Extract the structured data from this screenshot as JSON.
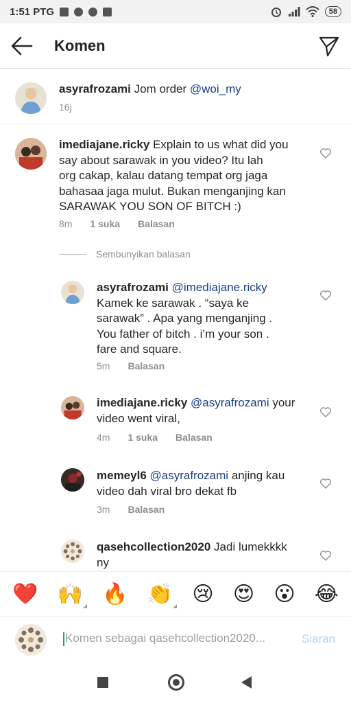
{
  "status_bar": {
    "time": "1:51 PTG",
    "battery": "58",
    "icons_left": [
      "message-icon",
      "facebook-icon",
      "app-icon",
      "store-icon"
    ],
    "icons_right": [
      "alarm-icon",
      "signal-icon",
      "wifi-icon",
      "battery-icon"
    ]
  },
  "header": {
    "title": "Komen",
    "back_icon": "arrow-left-icon",
    "send_icon": "paper-plane-icon"
  },
  "caption": {
    "username": "asyrafrozami",
    "text": "Jom order",
    "mention": "@woi_my",
    "time": "16j"
  },
  "comments": [
    {
      "username": "imediajane.ricky",
      "lines": [
        "Explain to us what did you",
        "say about sarawak in you video? Itu lah",
        "org  cakap, kalau datang tempat org jaga",
        "bahasaa jaga mulut. Bukan menganjing kan",
        "SARAWAK YOU SON OF BITCH :)"
      ],
      "time": "8m",
      "likes": "1 suka",
      "reply": "Balasan"
    }
  ],
  "hide_replies": "Sembunyikan balasan",
  "replies": [
    {
      "username": "asyrafrozami",
      "mention": "@imediajane.ricky",
      "lines": [
        "Kamek ke sarawak . “saya ke",
        "sarawak” . Apa yang menganjing .",
        "You father of bitch . i’m your son .",
        "fare and square."
      ],
      "time": "5m",
      "likes": "",
      "reply": "Balasan"
    },
    {
      "username": "imediajane.ricky",
      "mention": "@asyrafrozami",
      "first_line_rest": "your",
      "lines": [
        "video went viral,"
      ],
      "time": "4m",
      "likes": "1 suka",
      "reply": "Balasan"
    },
    {
      "username": "memeyl6",
      "mention": "@asyrafrozami",
      "first_line_rest": "anjing kau",
      "lines": [
        "video dah viral bro dekat fb"
      ],
      "time": "3m",
      "likes": "",
      "reply": "Balasan"
    },
    {
      "username": "qasehcollection2020",
      "first_line_rest": "Jadi lumekkkk",
      "lines": [
        "ny"
      ]
    }
  ],
  "emoji_bar": [
    "❤️",
    "🙌",
    "🔥",
    "👏",
    "😢",
    "😍",
    "😮",
    "😂"
  ],
  "input": {
    "placeholder": "Komen sebagai qasehcollection2020...",
    "post_label": "Siaran"
  },
  "colors": {
    "mention": "#1a3f8a",
    "secondary_text": "#8e8e8e",
    "post_disabled": "#b3d4ef",
    "caret": "#2a9d8f"
  }
}
